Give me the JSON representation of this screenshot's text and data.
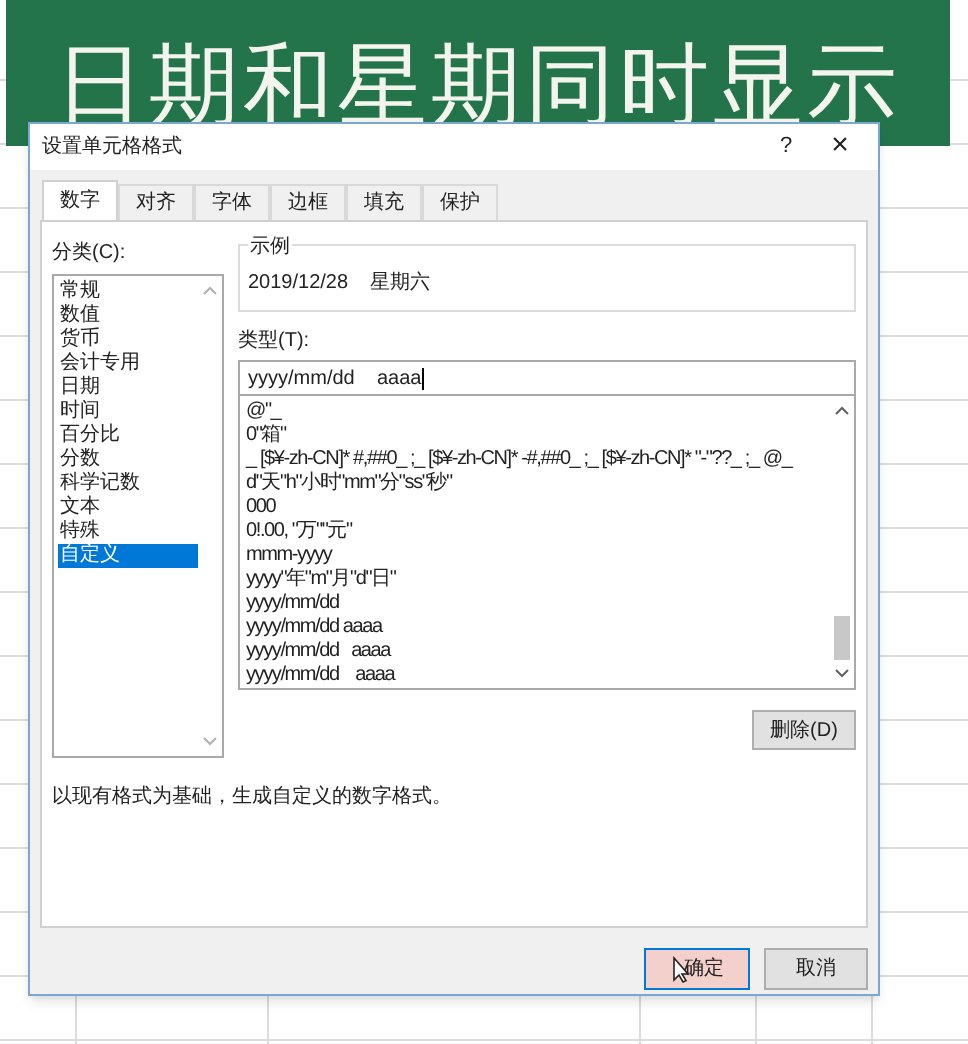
{
  "banner": {
    "title": "日期和星期同时显示"
  },
  "dialog": {
    "title": "设置单元格格式",
    "help": "?",
    "close": "×"
  },
  "tabs": [
    {
      "label": "数字",
      "selected": true
    },
    {
      "label": "对齐",
      "selected": false
    },
    {
      "label": "字体",
      "selected": false
    },
    {
      "label": "边框",
      "selected": false
    },
    {
      "label": "填充",
      "selected": false
    },
    {
      "label": "保护",
      "selected": false
    }
  ],
  "category": {
    "label": "分类(C):",
    "items": [
      {
        "label": "常规",
        "selected": false
      },
      {
        "label": "数值",
        "selected": false
      },
      {
        "label": "货币",
        "selected": false
      },
      {
        "label": "会计专用",
        "selected": false
      },
      {
        "label": "日期",
        "selected": false
      },
      {
        "label": "时间",
        "selected": false
      },
      {
        "label": "百分比",
        "selected": false
      },
      {
        "label": "分数",
        "selected": false
      },
      {
        "label": "科学记数",
        "selected": false
      },
      {
        "label": "文本",
        "selected": false
      },
      {
        "label": "特殊",
        "selected": false
      },
      {
        "label": "自定义",
        "selected": true
      }
    ]
  },
  "sample": {
    "label": "示例",
    "value": "2019/12/28    星期六"
  },
  "type": {
    "label": "类型(T):",
    "value": "yyyy/mm/dd    aaaa"
  },
  "formats": [
    "@\"_",
    "0\"箱\"",
    "_ [$¥-zh-CN]* #,##0_ ;_ [$¥-zh-CN]* -#,##0_ ;_ [$¥-zh-CN]* \"-\"??_ ;_ @_",
    "d\"天\"h\"小时\"mm\"分\"ss\"秒\"",
    "000",
    "0!.00, \"万\"\"元\"",
    "mmm-yyyy",
    "yyyy\"年\"m\"月\"d\"日\"",
    "yyyy/mm/dd",
    "yyyy/mm/dd aaaa",
    "yyyy/mm/dd   aaaa",
    "yyyy/mm/dd    aaaa"
  ],
  "delete_button": "删除(D)",
  "description": "以现有格式为基础，生成自定义的数字格式。",
  "buttons": [
    {
      "label": "确定",
      "kind": "primary"
    },
    {
      "label": "取消",
      "kind": "secondary"
    }
  ]
}
